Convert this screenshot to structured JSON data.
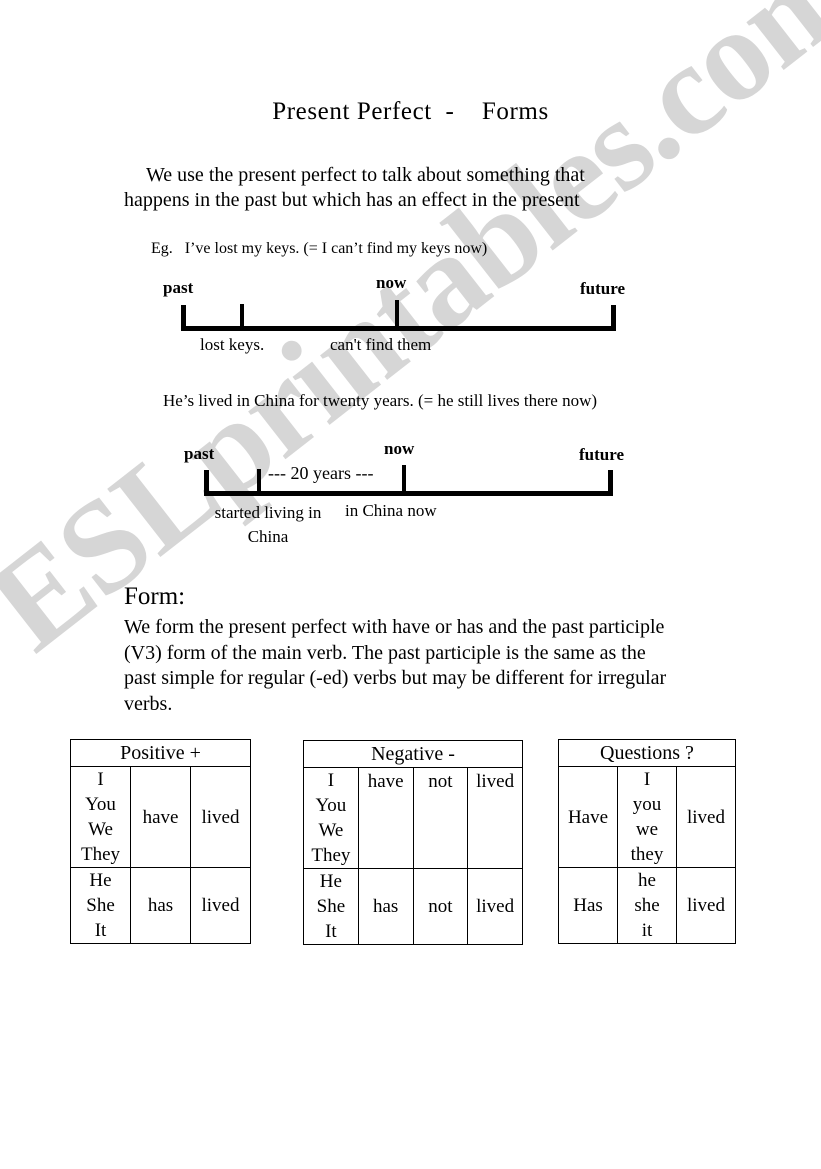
{
  "page": {
    "title": "Present Perfect  -    Forms",
    "watermark": "ESLprintables.com"
  },
  "intro": {
    "paragraph": "We use the present perfect to talk about something that happens in the past but which has an effect in the present",
    "example_one": "Eg.   I’ve lost my keys. (= I can’t find my keys now)",
    "example_two": "He’s lived in China for twenty years. (= he still lives there now)"
  },
  "timelines": [
    {
      "id": "keys",
      "past_label": "past",
      "now_label": "now",
      "future_label": "future",
      "sub_left": "lost  keys.",
      "sub_right": "can't find them",
      "span_label": ""
    },
    {
      "id": "china",
      "past_label": "past",
      "now_label": "now",
      "future_label": "future",
      "sub_left": "started living in China",
      "sub_right": "in China now",
      "span_label": "--- 20 years ---"
    }
  ],
  "form": {
    "heading": "Form:",
    "paragraph": "We form the present perfect with have or has and the past participle (V3) form of the main verb. The past participle is the same as the past simple for regular (-ed) verbs but may be different for irregular verbs."
  },
  "tables": {
    "positive": {
      "caption": "Positive +",
      "columns": 3,
      "rows": [
        {
          "subject": "I\nYou\nWe\nThey",
          "aux": "have",
          "not": "",
          "verb": "lived"
        },
        {
          "subject": "He\nShe\nIt",
          "aux": "has",
          "not": "",
          "verb": "lived"
        }
      ]
    },
    "negative": {
      "caption": "Negative -",
      "columns": 4,
      "rows": [
        {
          "subject": "I\nYou\nWe\nThey",
          "aux": "have",
          "not": "not",
          "verb": "lived"
        },
        {
          "subject": "He\nShe\nIt",
          "aux": "has",
          "not": "not",
          "verb": "lived"
        }
      ]
    },
    "questions": {
      "caption": "Questions ?",
      "columns": 3,
      "rows": [
        {
          "aux": "Have",
          "subject": "I\nyou\nwe\nthey",
          "verb": "lived"
        },
        {
          "aux": "Has",
          "subject": "he\nshe\nit",
          "verb": "lived"
        }
      ]
    }
  }
}
